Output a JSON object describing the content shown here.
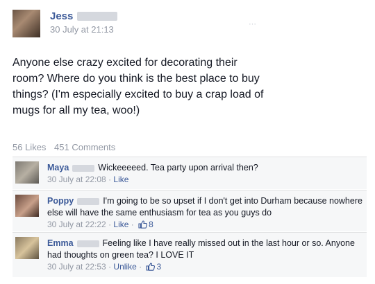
{
  "post": {
    "author": "Jess",
    "timestamp": "30 July at 21:13",
    "text": "Anyone else crazy excited for decorating their room? Where do you think is the best place to buy things? (I'm especially excited to buy a crap load of mugs for all my tea, woo!)",
    "likes": "56 Likes",
    "comments_count": "451 Comments"
  },
  "comments": [
    {
      "name": "Maya",
      "text": "Wickeeeeed. Tea party upon arrival then?",
      "time": "30 July at 22:08",
      "action": "Like",
      "like_count": ""
    },
    {
      "name": "Poppy",
      "text": "I'm going to be so upset if I don't get into Durham because nowhere else will have the same enthusiasm for tea as you guys do",
      "time": "30 July at 22:22",
      "action": "Like",
      "like_count": "8"
    },
    {
      "name": "Emma",
      "text": "Feeling like I have really missed out in the last hour or so. Anyone had thoughts on green tea? I LOVE IT",
      "time": "30 July at 22:53",
      "action": "Unlike",
      "like_count": "3"
    }
  ],
  "colors": {
    "link": "#3b5998",
    "meta": "#9197a3",
    "comment_bg": "#f6f7f8"
  }
}
